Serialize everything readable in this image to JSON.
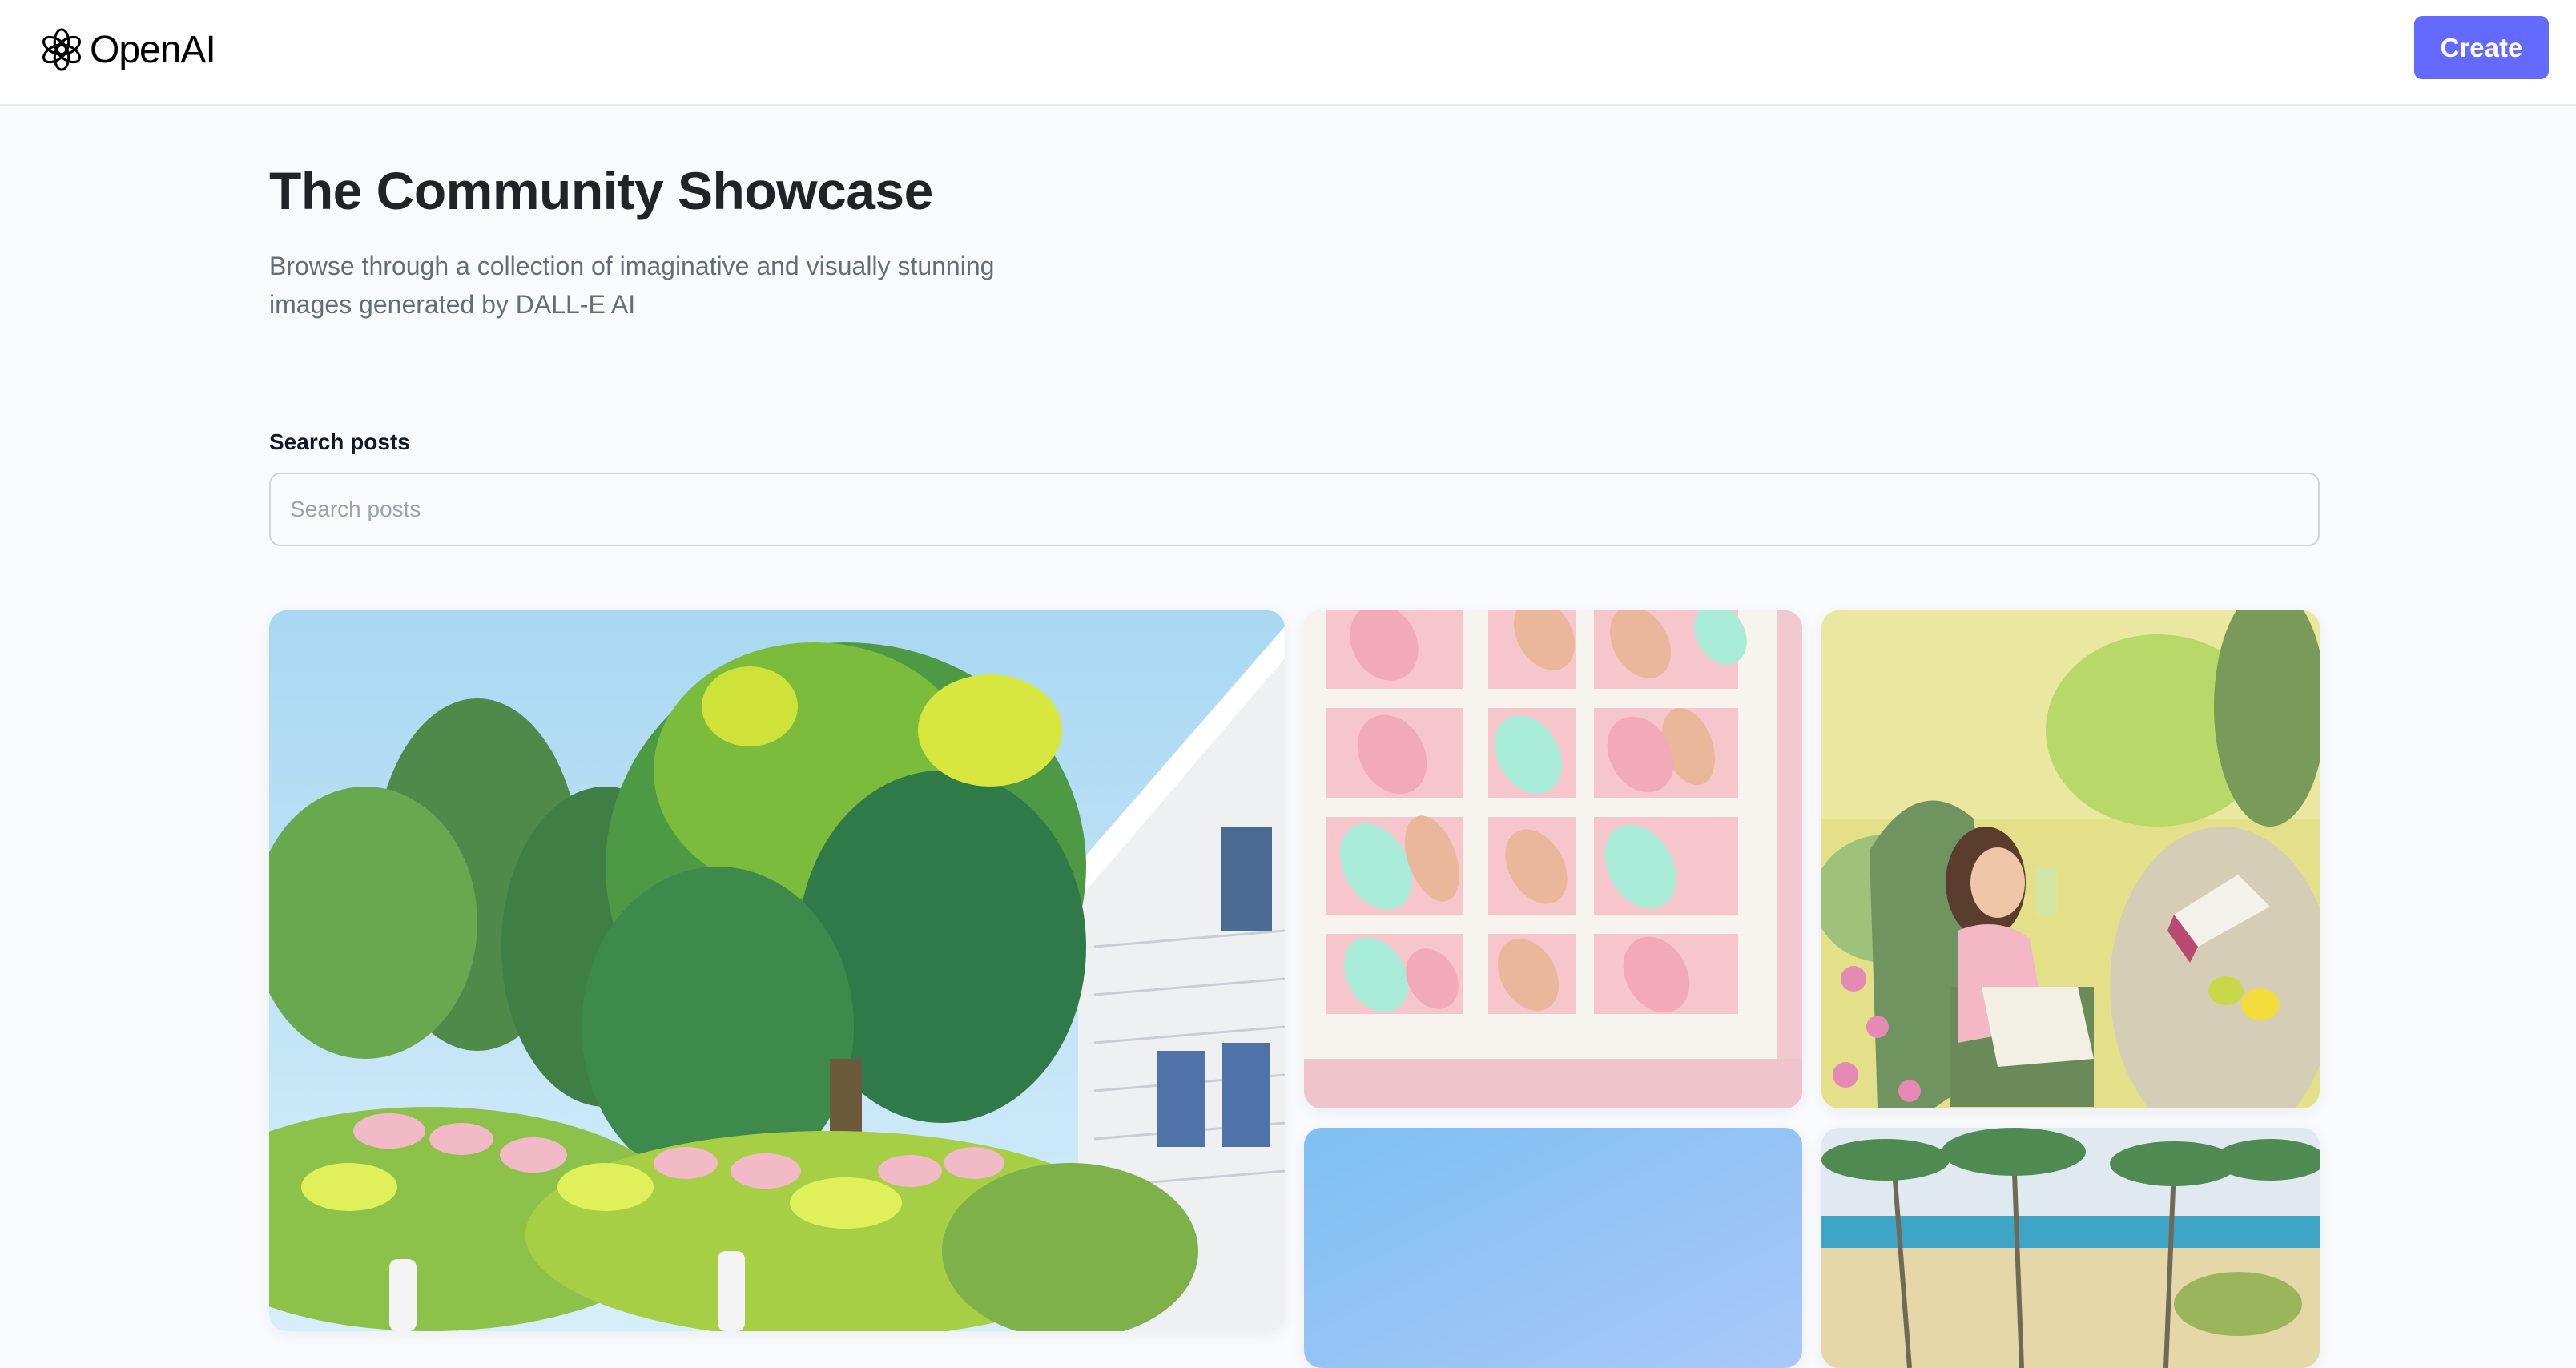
{
  "header": {
    "logo_text": "OpenAI",
    "logo_icon": "openai-logo-icon",
    "create_label": "Create"
  },
  "hero": {
    "title": "The Community Showcase",
    "subtitle_line1": "Browse through a collection of imaginative and visually stunning",
    "subtitle_line2": "images generated by DALL-E AI"
  },
  "search": {
    "label": "Search posts",
    "placeholder": "Search posts",
    "value": ""
  },
  "colors": {
    "accent": "#6469ff",
    "title": "#222328",
    "subtitle": "#666e75",
    "background": "#f9fafe"
  },
  "gallery": {
    "items": [
      {
        "name": "painting of house with garden and trees"
      },
      {
        "name": "pink and mint leaf pattern grid"
      },
      {
        "name": "girl drinking lemonade reading book painting"
      },
      {
        "name": "blue sky gradient"
      },
      {
        "name": "tropical beach with palm trees painting"
      }
    ]
  }
}
